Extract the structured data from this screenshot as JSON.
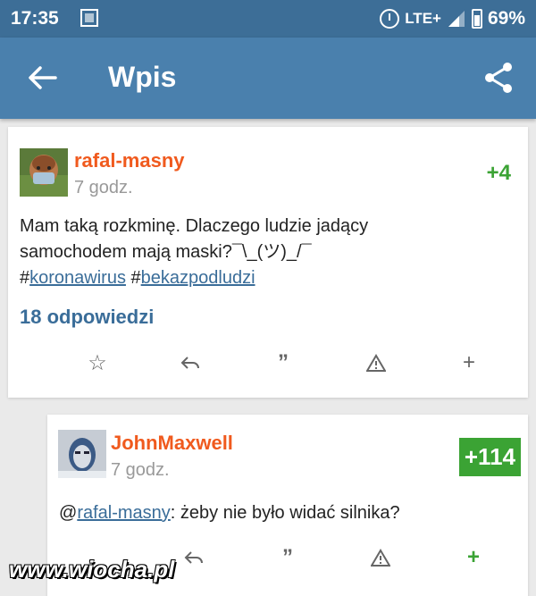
{
  "status_bar": {
    "time": "17:35",
    "network": "LTE+",
    "battery": "69%"
  },
  "app_bar": {
    "title": "Wpis"
  },
  "post": {
    "author": "rafal-masny",
    "time": "7 godz.",
    "votes": "+4",
    "text_line1": "Mam taką rozkminę. Dlaczego ludzie jadący",
    "text_line2": "samochodem mają maski?¯\\_(ツ)_/¯",
    "tags": [
      "koronawirus",
      "bekazpodludzi"
    ],
    "replies": "18 odpowiedzi"
  },
  "comment": {
    "author": "JohnMaxwell",
    "time": "7 godz.",
    "votes": "+114",
    "mention": "rafal-masny",
    "text": ": żeby nie było widać silnika?"
  },
  "watermark": "www.wiocha.pl"
}
